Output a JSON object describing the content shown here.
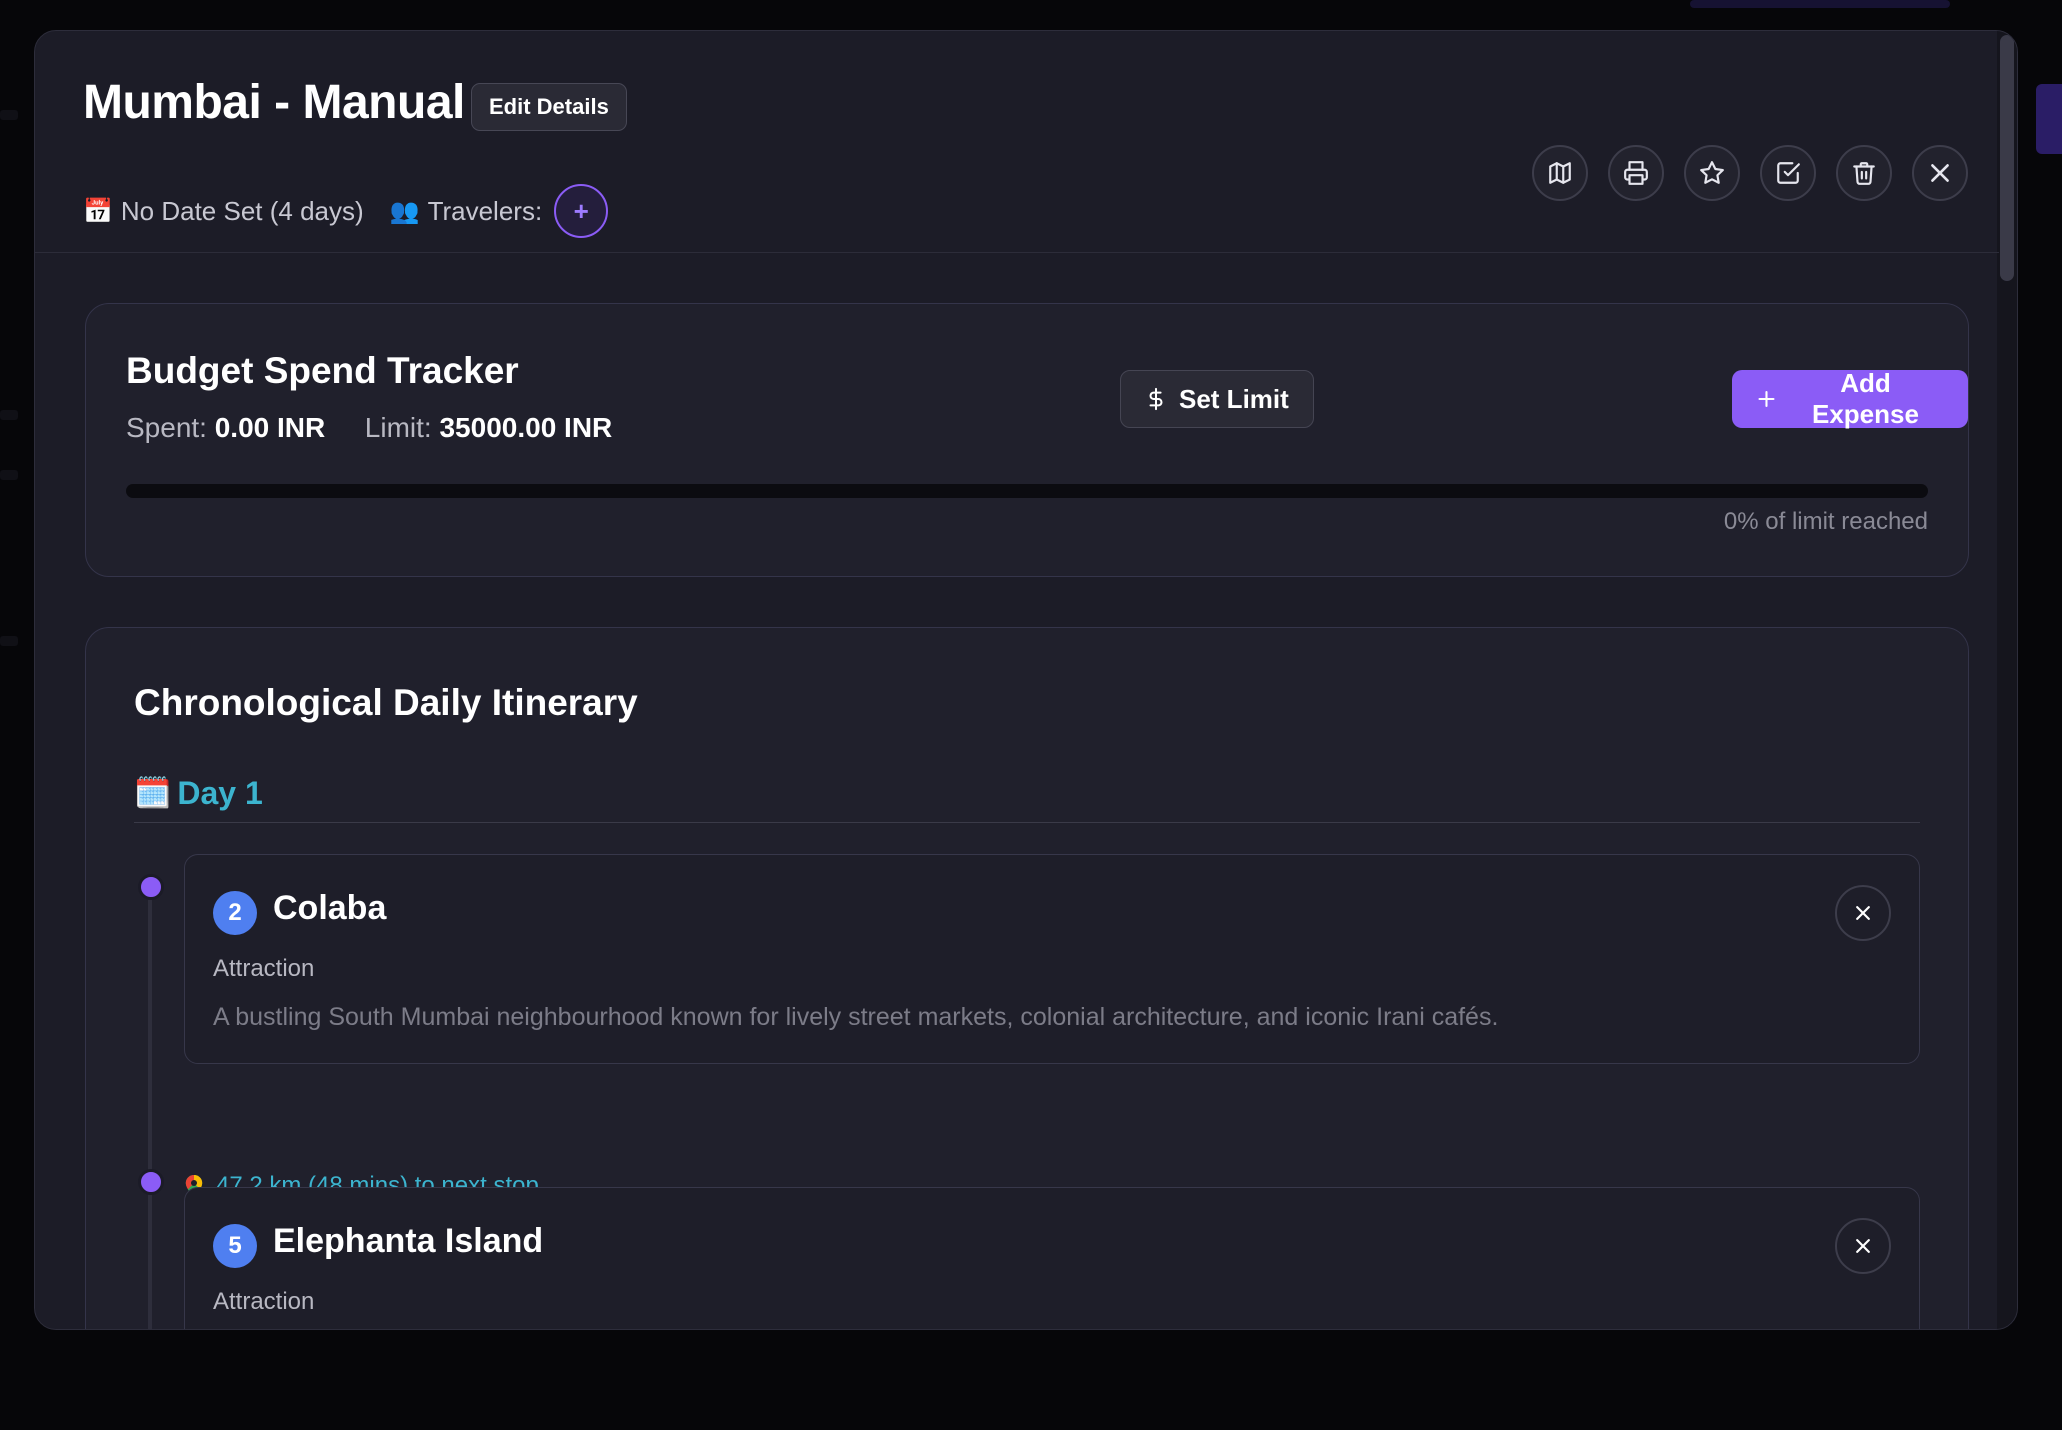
{
  "trip": {
    "title": "Mumbai - Manual",
    "edit_label": "Edit Details",
    "date_emoji": "📅",
    "date_text": "No Date Set (4 days)",
    "travelers_emoji": "👥",
    "travelers_label": "Travelers:",
    "add_traveler_symbol": "+"
  },
  "header_actions": [
    {
      "icon": "map-icon"
    },
    {
      "icon": "printer-icon"
    },
    {
      "icon": "star-icon"
    },
    {
      "icon": "checkbox-icon"
    },
    {
      "icon": "trash-icon"
    },
    {
      "icon": "close-icon"
    }
  ],
  "budget": {
    "title": "Budget Spend Tracker",
    "spent_label": "Spent:",
    "spent_value": "0.00 INR",
    "limit_label": "Limit:",
    "limit_value": "35000.00 INR",
    "set_limit_label": "Set Limit",
    "add_expense_label": "Add Expense",
    "progress_percent": 0,
    "progress_text": "0% of limit reached"
  },
  "itinerary": {
    "title": "Chronological Daily Itinerary",
    "days": [
      {
        "emoji": "🗓️",
        "label": "Day 1",
        "stops": [
          {
            "number": "2",
            "name": "Colaba",
            "type": "Attraction",
            "description": "A bustling South Mumbai neighbourhood known for lively street markets, colonial architecture, and iconic Irani cafés."
          },
          {
            "number": "5",
            "name": "Elephanta Island",
            "type": "Attraction"
          }
        ],
        "travel_legs": [
          {
            "text": "47.2 km (48 mins) to next stop"
          }
        ]
      }
    ]
  },
  "colors": {
    "accent": "#8b5cf6",
    "day_label": "#3cb4cf",
    "stop_badge": "#4f7ff0",
    "modal_bg": "#1c1c27",
    "page_bg": "#060609"
  }
}
